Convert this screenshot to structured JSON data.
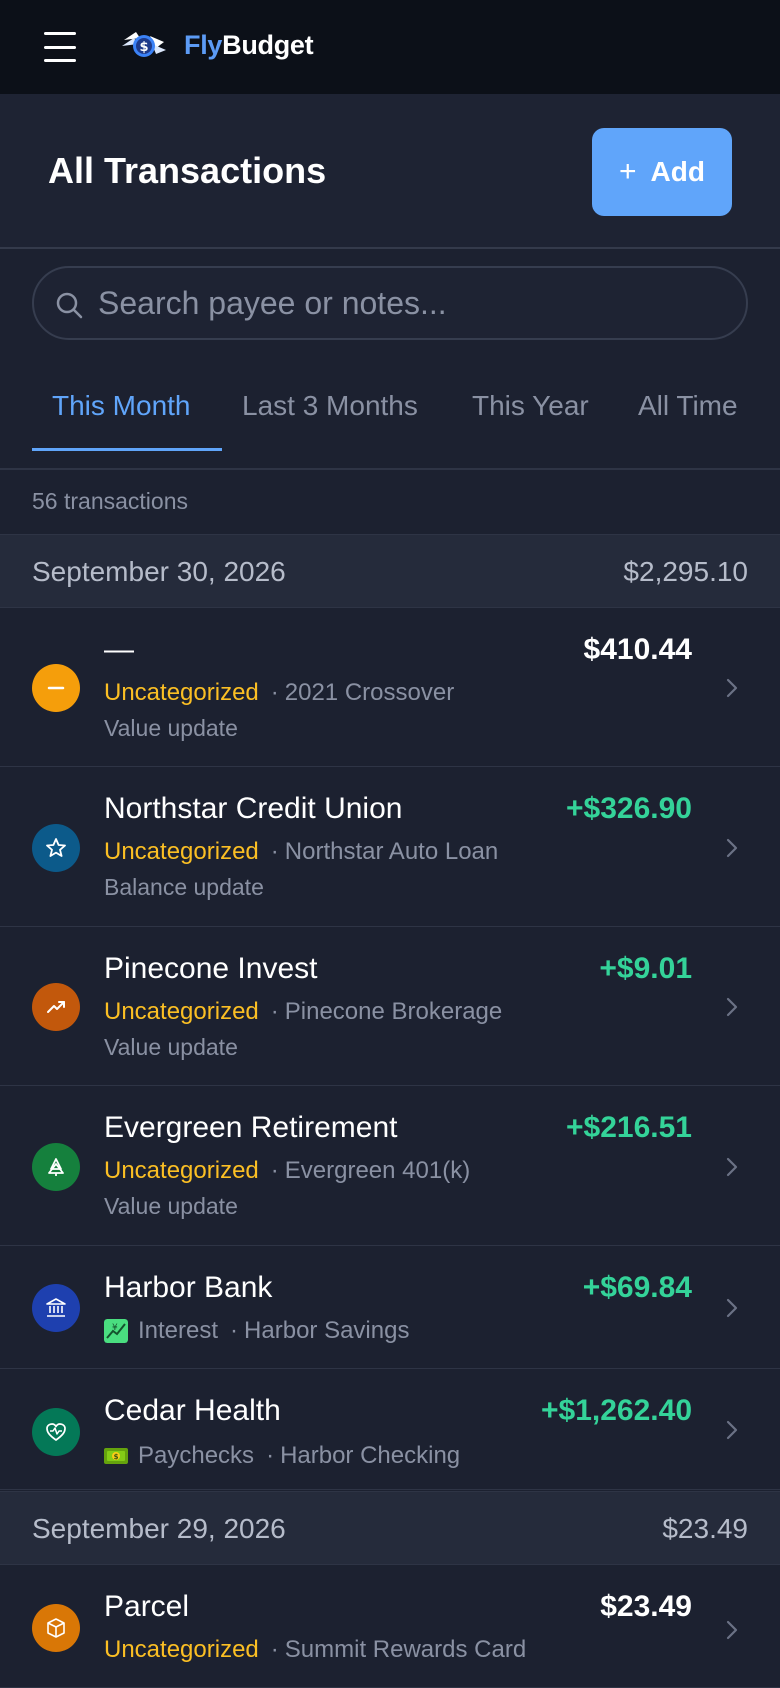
{
  "app": {
    "brand_first": "Fly",
    "brand_second": "Budget",
    "logo": "flying-money-icon"
  },
  "header": {
    "title": "All Transactions",
    "add_label": "Add"
  },
  "search": {
    "placeholder": "Search payee or notes...",
    "value": ""
  },
  "tabs": [
    {
      "label": "This Month",
      "active": true
    },
    {
      "label": "Last 3 Months",
      "active": false
    },
    {
      "label": "This Year",
      "active": false
    },
    {
      "label": "All Time",
      "active": false
    }
  ],
  "count_label": "56 transactions",
  "colors": {
    "accent": "#60a5fa",
    "positive": "#34d399",
    "uncategorized": "#fbbf24"
  },
  "groups": [
    {
      "date": "September 30, 2026",
      "total": "$2,295.10",
      "transactions": [
        {
          "payee": "—",
          "amount": "$410.44",
          "positive": false,
          "category": "Uncategorized",
          "account": "2021 Crossover",
          "note": "Value update",
          "icon": "minus-icon",
          "icon_color": "#f59e0b"
        },
        {
          "payee": "Northstar Credit Union",
          "amount": "+$326.90",
          "positive": true,
          "category": "Uncategorized",
          "account": "Northstar Auto Loan",
          "note": "Balance update",
          "icon": "star-icon",
          "icon_color": "#0c5a8a"
        },
        {
          "payee": "Pinecone Invest",
          "amount": "+$9.01",
          "positive": true,
          "category": "Uncategorized",
          "account": "Pinecone Brokerage",
          "note": "Value update",
          "icon": "trend-up-icon",
          "icon_color": "#c2580c"
        },
        {
          "payee": "Evergreen Retirement",
          "amount": "+$216.51",
          "positive": true,
          "category": "Uncategorized",
          "account": "Evergreen 401(k)",
          "note": "Value update",
          "icon": "tree-icon",
          "icon_color": "#15803d"
        },
        {
          "payee": "Harbor Bank",
          "amount": "+$69.84",
          "positive": true,
          "category": "Interest",
          "account": "Harbor Savings",
          "note": "",
          "icon": "bank-icon",
          "icon_color": "#1e40af",
          "category_emoji": "chart-yen-icon"
        },
        {
          "payee": "Cedar Health",
          "amount": "+$1,262.40",
          "positive": true,
          "category": "Paychecks",
          "account": "Harbor Checking",
          "note": "",
          "icon": "heart-pulse-icon",
          "icon_color": "#047857",
          "category_emoji": "dollar-bill-icon"
        }
      ]
    },
    {
      "date": "September 29, 2026",
      "total": "$23.49",
      "transactions": [
        {
          "payee": "Parcel",
          "amount": "$23.49",
          "positive": false,
          "category": "Uncategorized",
          "account": "Summit Rewards Card",
          "note": "",
          "icon": "package-icon",
          "icon_color": "#d97706"
        }
      ]
    }
  ]
}
